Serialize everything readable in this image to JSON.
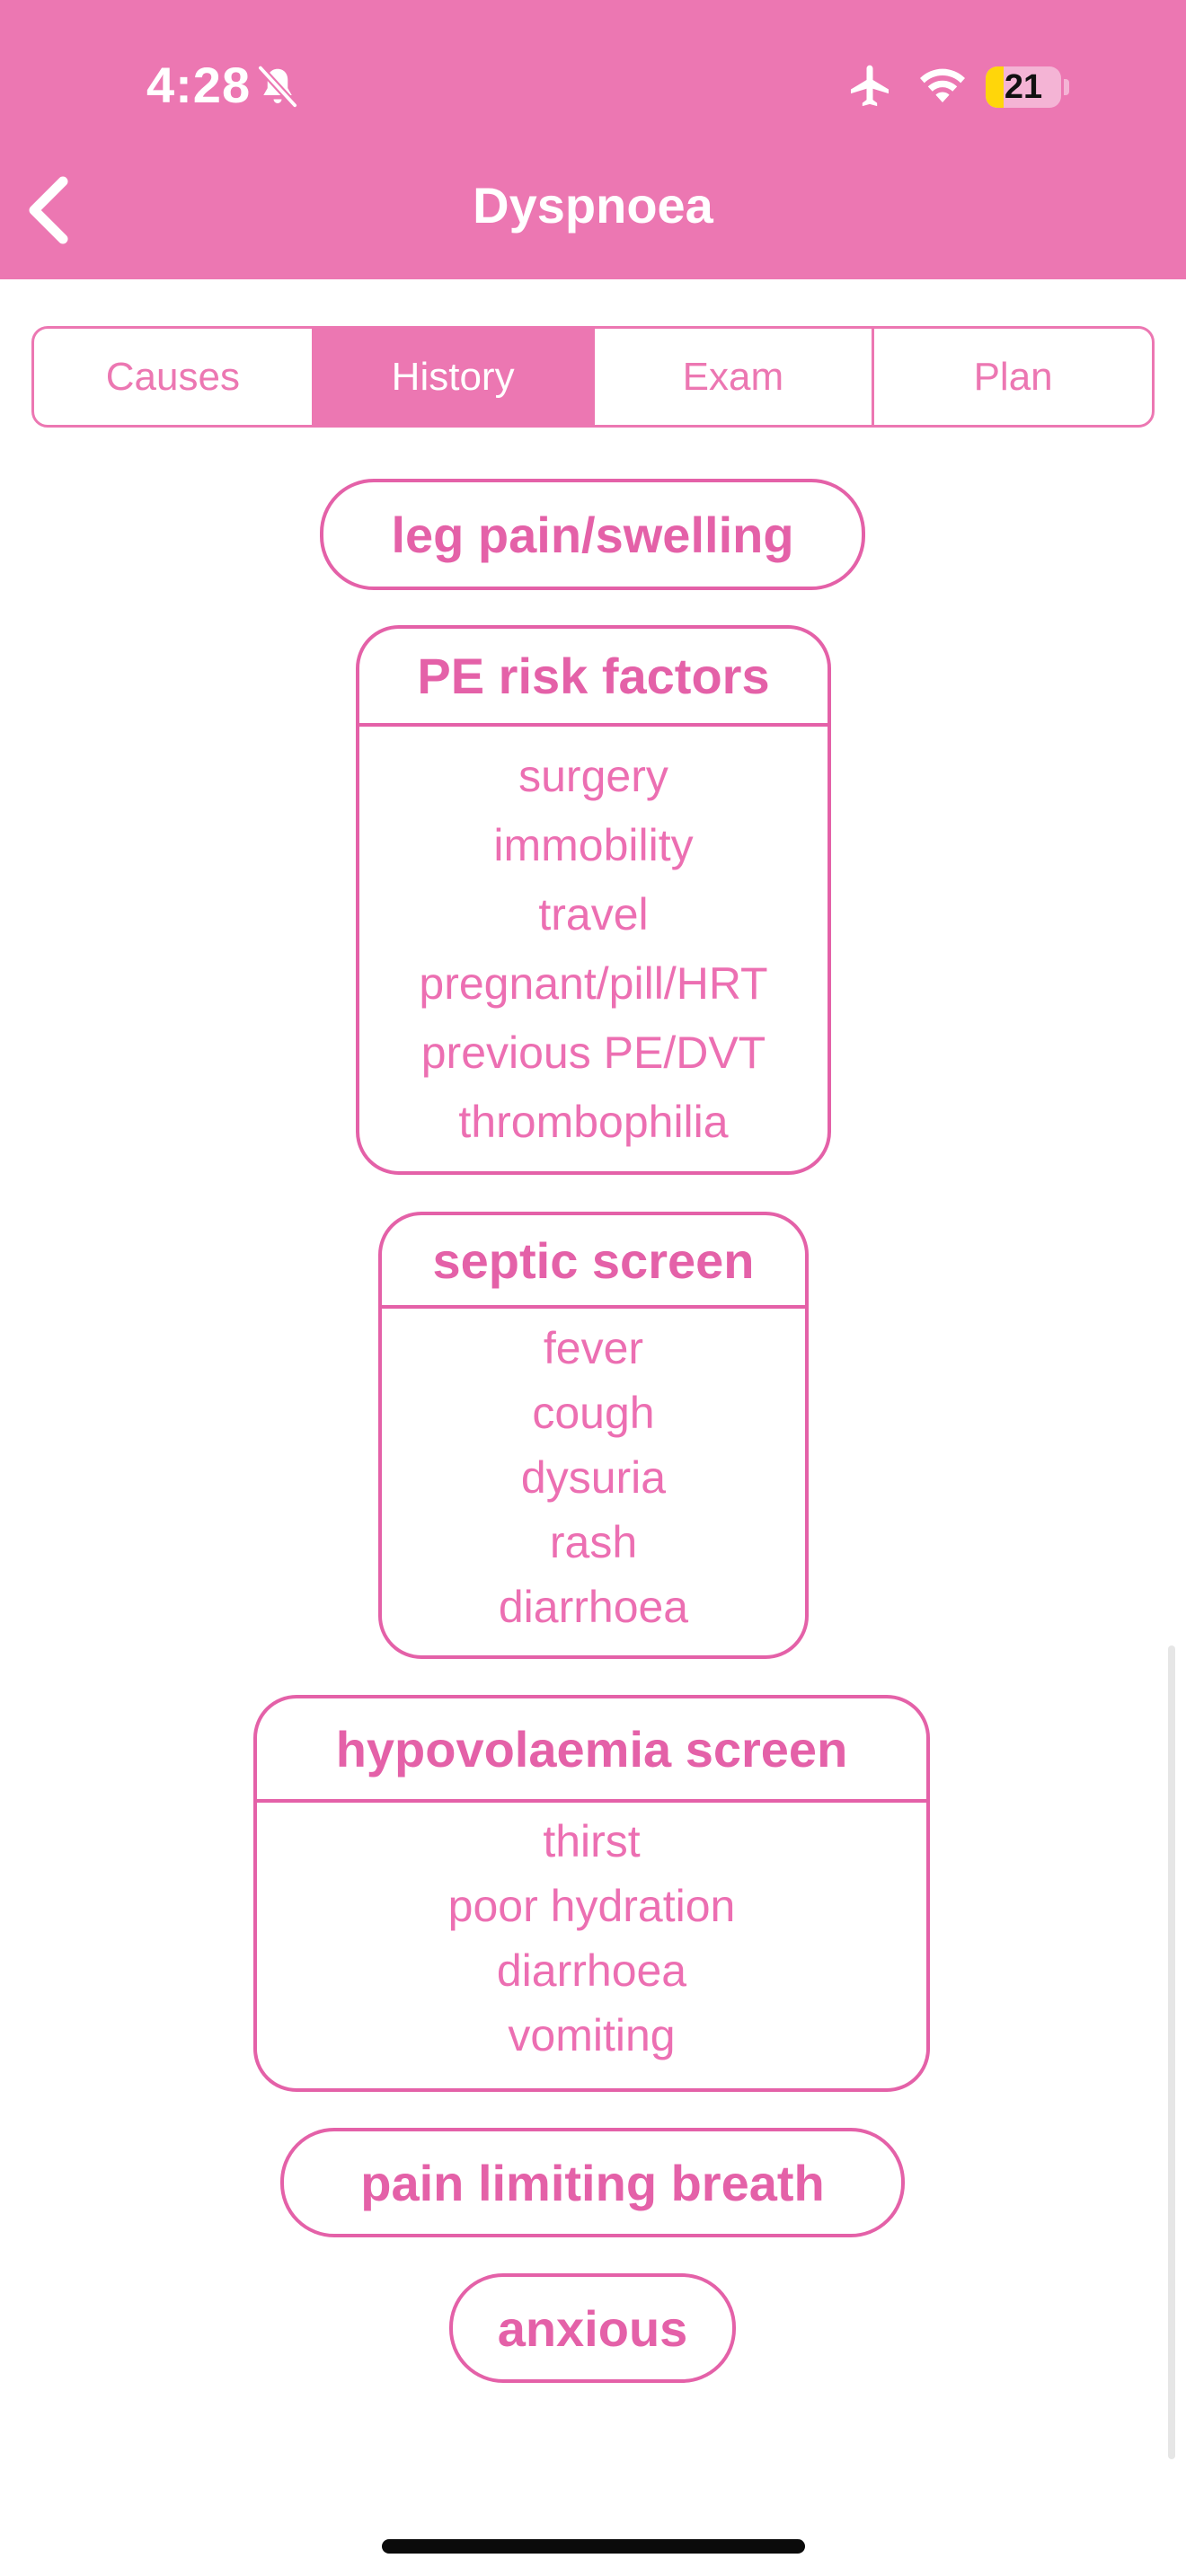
{
  "status_bar": {
    "time": "4:28",
    "battery_level": "21",
    "battery_percent": 21
  },
  "nav": {
    "title": "Dyspnoea",
    "back_icon": "chevron-left-icon"
  },
  "tabs": [
    {
      "label": "Causes",
      "active": false
    },
    {
      "label": "History",
      "active": true
    },
    {
      "label": "Exam",
      "active": false
    },
    {
      "label": "Plan",
      "active": false
    }
  ],
  "content": {
    "leg_pain": "leg pain/swelling",
    "pe_risk": {
      "title": "PE risk factors",
      "items": [
        "surgery",
        "immobility",
        "travel",
        "pregnant/pill/HRT",
        "previous PE/DVT",
        "thrombophilia"
      ]
    },
    "septic": {
      "title": "septic screen",
      "items": [
        "fever",
        "cough",
        "dysuria",
        "rash",
        "diarrhoea"
      ]
    },
    "hypovolaemia": {
      "title": "hypovolaemia screen",
      "items": [
        "thirst",
        "poor hydration",
        "diarrhoea",
        "vomiting"
      ]
    },
    "pain_limiting": "pain limiting breath",
    "anxious": "anxious"
  },
  "colors": {
    "header": "#ec77b2",
    "accent": "#e461a8",
    "battery": "#ffd60a"
  }
}
